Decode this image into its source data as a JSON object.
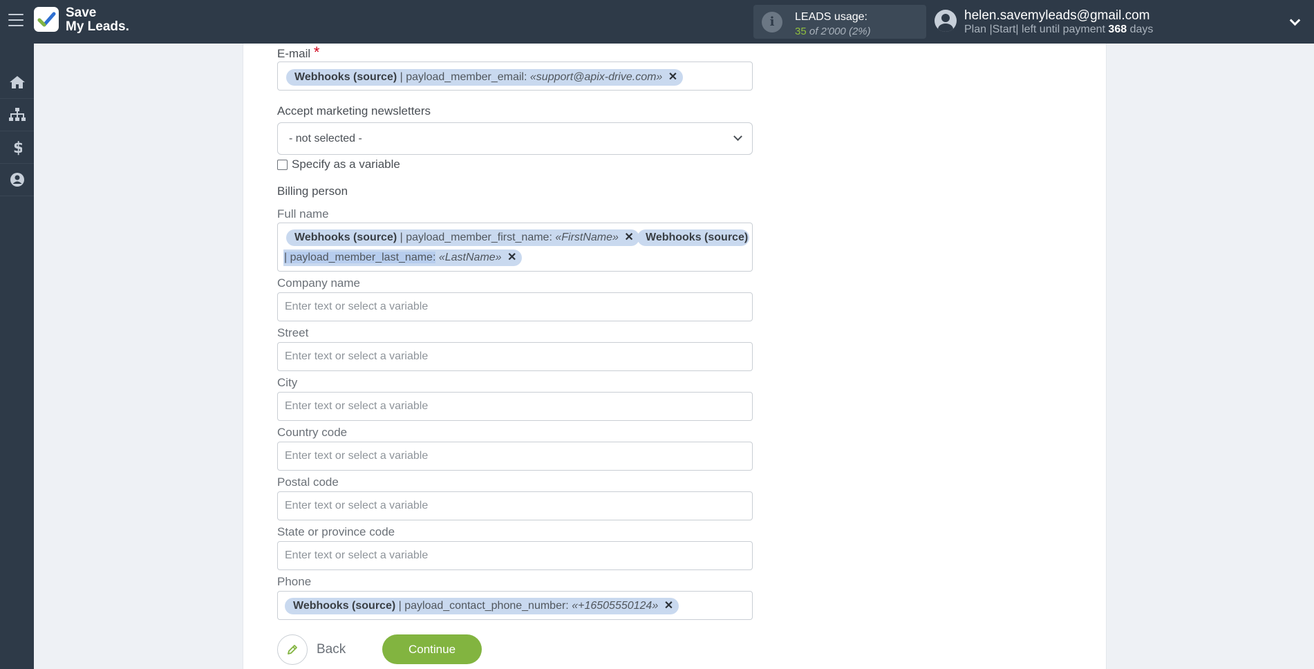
{
  "header": {
    "logo_line1": "Save",
    "logo_line2": "My Leads.",
    "leads_label": "LEADS usage:",
    "leads_used": "35",
    "leads_of": "of 2'000",
    "leads_percent": "(2%)",
    "user_email": "helen.savemyleads@gmail.com",
    "plan_prefix": "Plan |Start| left until payment",
    "plan_days": "368",
    "plan_suffix": "days"
  },
  "sidebar": {
    "items": [
      "home-icon",
      "sitemap-icon",
      "dollar-icon",
      "user-icon"
    ]
  },
  "form": {
    "email": {
      "label": "E-mail",
      "required": "*",
      "chip": {
        "source": "Webhooks (source)",
        "field": "| payload_member_email:",
        "value": "«support@apix-drive.com»",
        "remove": "✕"
      }
    },
    "newsletters": {
      "label": "Accept marketing newsletters",
      "selected": "- not selected -"
    },
    "specify_variable": "Specify as a variable",
    "billing_person": "Billing person",
    "full_name": {
      "label": "Full name",
      "chip1": {
        "source": "Webhooks (source)",
        "field": "| payload_member_first_name:",
        "value": "«FirstName»",
        "remove": "✕"
      },
      "chip2_source": "Webhooks (source)",
      "chip2_field": "| payload_member_last_name:",
      "chip2_value": "«LastName»",
      "chip2_remove": "✕"
    },
    "company_name": {
      "label": "Company name",
      "placeholder": "Enter text or select a variable"
    },
    "street": {
      "label": "Street",
      "placeholder": "Enter text or select a variable"
    },
    "city": {
      "label": "City",
      "placeholder": "Enter text or select a variable"
    },
    "country_code": {
      "label": "Country code",
      "placeholder": "Enter text or select a variable"
    },
    "postal_code": {
      "label": "Postal code",
      "placeholder": "Enter text or select a variable"
    },
    "state_code": {
      "label": "State or province code",
      "placeholder": "Enter text or select a variable"
    },
    "phone": {
      "label": "Phone",
      "chip": {
        "source": "Webhooks (source)",
        "field": "| payload_contact_phone_number:",
        "value": "«+16505550124»",
        "remove": "✕"
      }
    }
  },
  "actions": {
    "back": "Back",
    "continue": "Continue"
  },
  "colors": {
    "topbar": "#2e3a48",
    "accent_green": "#82b440",
    "chip_bg": "#c9d9ef"
  }
}
